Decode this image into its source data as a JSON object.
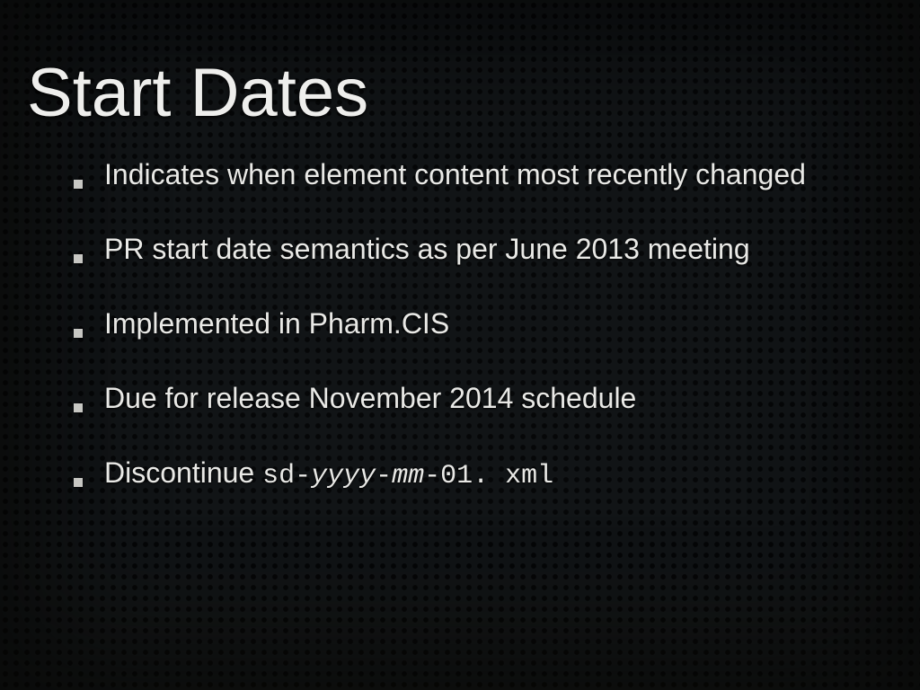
{
  "slide": {
    "title": "Start Dates",
    "bullets": [
      {
        "text": "Indicates when element content most recently changed"
      },
      {
        "text": "PR start date semantics as per June 2013 meeting"
      },
      {
        "text": "Implemented in Pharm.CIS"
      },
      {
        "text": "Due for release November 2014 schedule"
      },
      {
        "text_prefix": "Discontinue ",
        "code_prefix": "sd-",
        "code_var1": "yyyy",
        "code_mid": "-",
        "code_var2": "mm",
        "code_suffix": "-01. xml"
      }
    ]
  }
}
